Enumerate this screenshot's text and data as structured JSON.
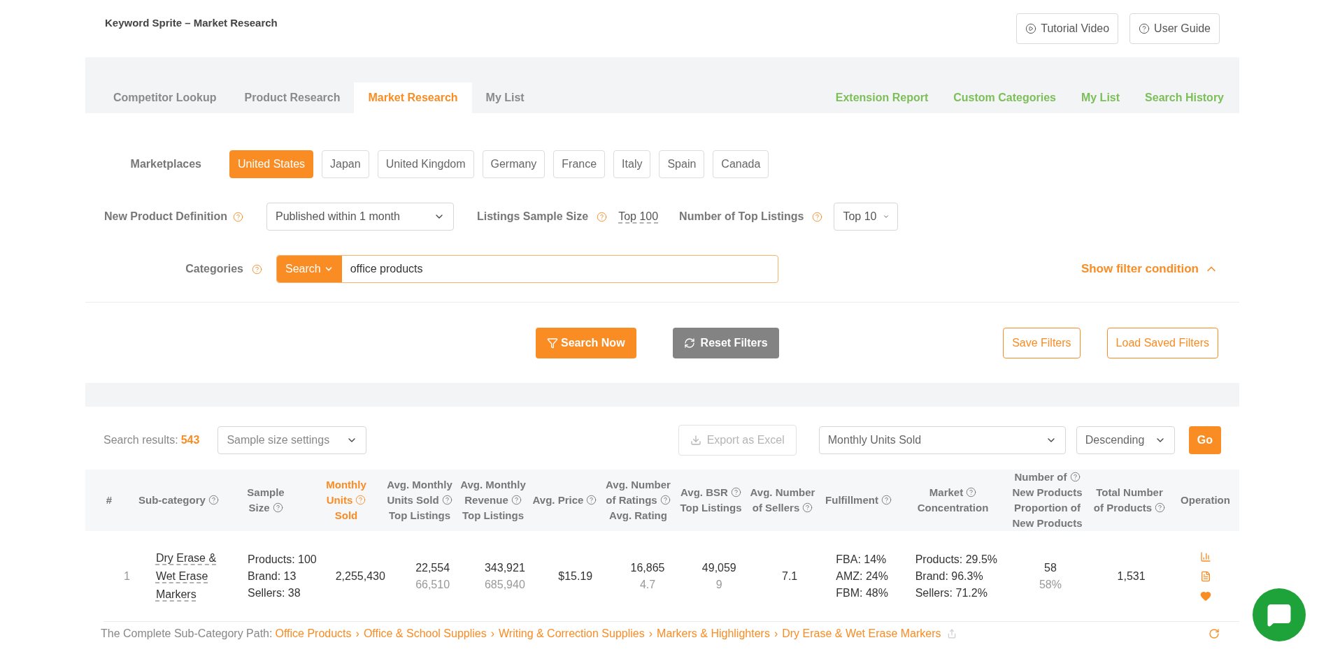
{
  "header": {
    "title": "Keyword Sprite – Market Research",
    "buttons": [
      {
        "kind": "video",
        "label": "Tutorial Video"
      },
      {
        "kind": "guide",
        "label": "User Guide"
      }
    ]
  },
  "tabs": [
    {
      "label": "Competitor Lookup",
      "selected": false
    },
    {
      "label": "Product Research",
      "selected": false
    },
    {
      "label": "Market Research",
      "selected": true
    },
    {
      "label": "My List",
      "selected": false
    }
  ],
  "links": [
    "Extension Report",
    "Custom Categories",
    "My List",
    "Search History"
  ],
  "filters": {
    "marketplaces": {
      "label": "Marketplaces",
      "options": [
        {
          "label": "United States",
          "selected": true
        },
        {
          "label": "Japan",
          "selected": false
        },
        {
          "label": "United Kingdom",
          "selected": false
        },
        {
          "label": "Germany",
          "selected": false
        },
        {
          "label": "France",
          "selected": false
        },
        {
          "label": "Italy",
          "selected": false
        },
        {
          "label": "Spain",
          "selected": false
        },
        {
          "label": "Canada",
          "selected": false
        }
      ]
    },
    "new_product": {
      "label": "New Product Definition",
      "value": "Published within 1 month"
    },
    "sample_size": {
      "label": "Listings Sample Size",
      "value": "Top 100"
    },
    "top_listings": {
      "label": "Number of Top Listings",
      "value": "Top 10"
    },
    "categories": {
      "label": "Categories",
      "mode": "Search",
      "value": "office products"
    },
    "toggle": "Show filter condition",
    "actions": {
      "search": "Search Now",
      "reset": "Reset Filters",
      "save": "Save Filters",
      "load": "Load Saved Filters"
    }
  },
  "results": {
    "label": "Search results:",
    "count": "543",
    "sample_settings": "Sample size settings",
    "export": {
      "label": "Export as Excel",
      "disabled": true
    },
    "sort_by": "Monthly Units Sold",
    "order": "Descending",
    "go": "Go"
  },
  "table": {
    "columns": [
      {
        "lines": [
          {
            "text": "#",
            "help": false
          }
        ],
        "highlighted": false
      },
      {
        "lines": [
          {
            "text": "Sub-category",
            "help": true
          }
        ],
        "highlighted": false
      },
      {
        "lines": [
          {
            "text": "Sample",
            "help": false
          },
          {
            "text": "Size",
            "help": true
          }
        ],
        "highlighted": false
      },
      {
        "lines": [
          {
            "text": "Monthly",
            "help": false
          },
          {
            "text": "Units",
            "help": true
          },
          {
            "text": "Sold",
            "help": false
          }
        ],
        "highlighted": true
      },
      {
        "lines": [
          {
            "text": "Avg. Monthly",
            "help": false
          },
          {
            "text": "Units Sold",
            "help": true
          },
          {
            "text": "Top Listings",
            "help": false
          }
        ],
        "highlighted": false
      },
      {
        "lines": [
          {
            "text": "Avg. Monthly",
            "help": false
          },
          {
            "text": "Revenue",
            "help": true
          },
          {
            "text": "Top Listings",
            "help": false
          }
        ],
        "highlighted": false
      },
      {
        "lines": [
          {
            "text": "Avg. Price",
            "help": true
          }
        ],
        "highlighted": false
      },
      {
        "lines": [
          {
            "text": "Avg. Number",
            "help": false
          },
          {
            "text": "of Ratings",
            "help": true
          },
          {
            "text": "Avg. Rating",
            "help": false
          }
        ],
        "highlighted": false
      },
      {
        "lines": [
          {
            "text": "Avg. BSR",
            "help": true
          },
          {
            "text": "Top Listings",
            "help": false
          }
        ],
        "highlighted": false
      },
      {
        "lines": [
          {
            "text": "Avg. Number",
            "help": false
          },
          {
            "text": "of Sellers",
            "help": true
          }
        ],
        "highlighted": false
      },
      {
        "lines": [
          {
            "text": "Fulfillment",
            "help": true
          }
        ],
        "highlighted": false
      },
      {
        "lines": [
          {
            "text": "Market",
            "help": true
          },
          {
            "text": "Concentration",
            "help": false
          }
        ],
        "highlighted": false
      },
      {
        "lines": [
          {
            "text": "Number of",
            "help": true
          },
          {
            "text": "New Products",
            "help": false
          },
          {
            "text": "Proportion of",
            "help": false
          },
          {
            "text": "New Products",
            "help": false
          }
        ],
        "highlighted": false
      },
      {
        "lines": [
          {
            "text": "Total Number",
            "help": false
          },
          {
            "text": "of Products",
            "help": true
          }
        ],
        "highlighted": false
      },
      {
        "lines": [
          {
            "text": "Operation",
            "help": false
          }
        ],
        "highlighted": false
      }
    ],
    "rows": [
      {
        "cells": [
          {
            "kind": "index",
            "lines": [
              {
                "text": "1",
                "muted": true
              }
            ]
          },
          {
            "kind": "link",
            "lines": [
              {
                "text": "Dry Erase & Wet Erase Markers",
                "muted": false
              }
            ]
          },
          {
            "kind": "list",
            "lines": [
              {
                "text": "Products: 100",
                "muted": false
              },
              {
                "text": "Brand: 13",
                "muted": false
              },
              {
                "text": "Sellers: 38",
                "muted": false
              }
            ]
          },
          {
            "kind": "center",
            "lines": [
              {
                "text": "2,255,430",
                "muted": false
              }
            ]
          },
          {
            "kind": "center",
            "lines": [
              {
                "text": "22,554",
                "muted": false
              },
              {
                "text": "66,510",
                "muted": true
              }
            ]
          },
          {
            "kind": "center",
            "lines": [
              {
                "text": "343,921",
                "muted": false
              },
              {
                "text": "685,940",
                "muted": true
              }
            ]
          },
          {
            "kind": "center",
            "lines": [
              {
                "text": "$15.19",
                "muted": false
              }
            ]
          },
          {
            "kind": "center",
            "lines": [
              {
                "text": "16,865",
                "muted": false
              },
              {
                "text": "4.7",
                "muted": true
              }
            ]
          },
          {
            "kind": "center",
            "lines": [
              {
                "text": "49,059",
                "muted": false
              },
              {
                "text": "9",
                "muted": true
              }
            ]
          },
          {
            "kind": "center",
            "lines": [
              {
                "text": "7.1",
                "muted": false
              }
            ]
          },
          {
            "kind": "list",
            "lines": [
              {
                "text": "FBA: 14%",
                "muted": false
              },
              {
                "text": "AMZ: 24%",
                "muted": false
              },
              {
                "text": "FBM: 48%",
                "muted": false
              }
            ]
          },
          {
            "kind": "list",
            "lines": [
              {
                "text": "Products: 29.5%",
                "muted": false
              },
              {
                "text": "Brand: 96.3%",
                "muted": false
              },
              {
                "text": "Sellers: 71.2%",
                "muted": false
              }
            ]
          },
          {
            "kind": "center",
            "lines": [
              {
                "text": "58",
                "muted": false
              },
              {
                "text": "58%",
                "muted": true
              }
            ]
          },
          {
            "kind": "center",
            "lines": [
              {
                "text": "1,531",
                "muted": false
              }
            ]
          },
          {
            "kind": "actions"
          }
        ],
        "path": {
          "label": "The Complete Sub-Category Path:",
          "segments": [
            "Office Products",
            "Office & School Supplies",
            "Writing & Correction Supplies",
            "Markers & Highlighters",
            "Dry Erase & Wet Erase Markers"
          ],
          "separator": "›"
        }
      }
    ]
  }
}
